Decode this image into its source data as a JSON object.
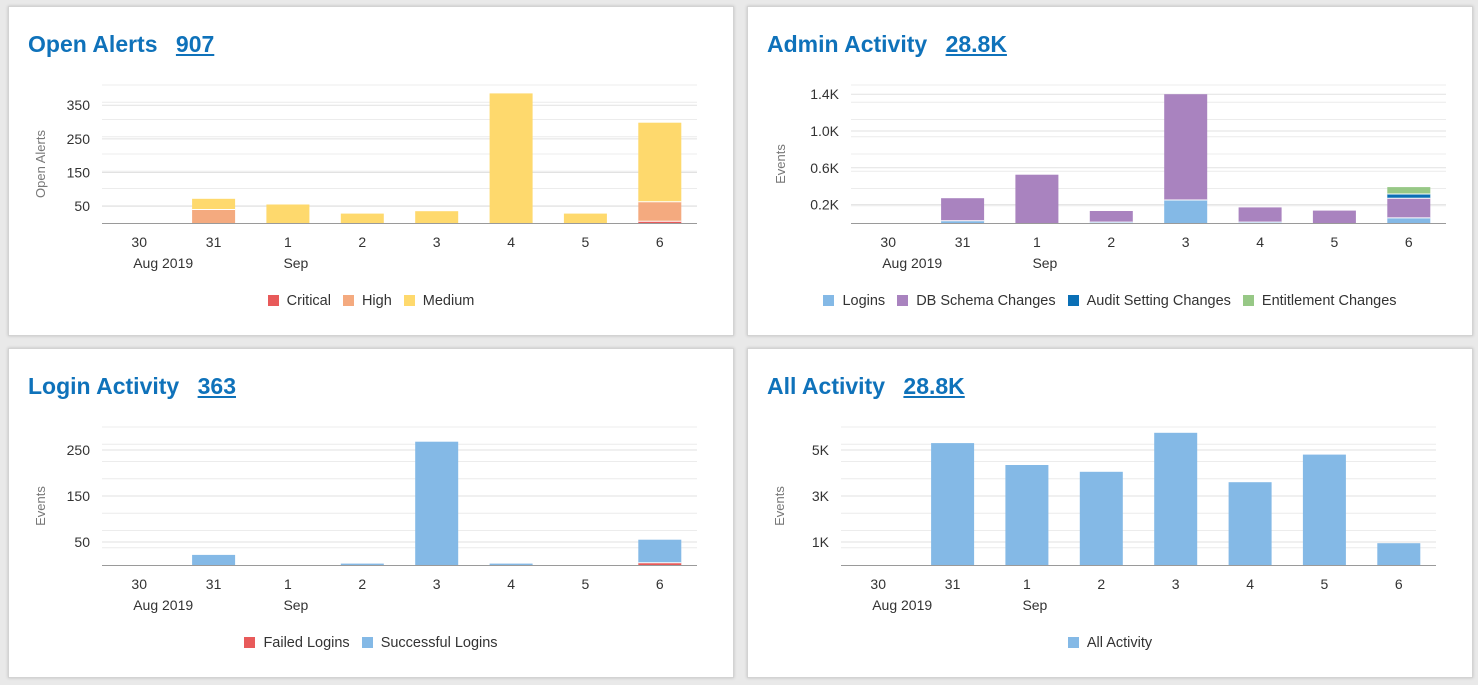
{
  "panels": [
    {
      "title": "Open Alerts",
      "total": "907",
      "chart_data": {
        "type": "bar",
        "stacked": true,
        "categories": [
          "30",
          "31",
          "1",
          "2",
          "3",
          "4",
          "5",
          "6"
        ],
        "category_groups": [
          "Aug 2019",
          "",
          "Sep",
          "",
          "",
          "",
          "",
          ""
        ],
        "ylabel": "Open Alerts",
        "yticks": [
          50,
          150,
          250,
          350
        ],
        "ytick_labels": [
          "50",
          "150",
          "250",
          "350"
        ],
        "ylim": [
          0,
          410
        ],
        "grid": true,
        "legend_position": "bottom",
        "series": [
          {
            "name": "Critical",
            "color": "#e85a5a",
            "values": [
              0,
              0,
              0,
              0,
              0,
              0,
              0,
              5
            ]
          },
          {
            "name": "High",
            "color": "#f4aa7f",
            "values": [
              0,
              40,
              0,
              0,
              0,
              0,
              0,
              58
            ]
          },
          {
            "name": "Medium",
            "color": "#fed96d",
            "values": [
              0,
              32,
              55,
              28,
              35,
              385,
              28,
              235
            ]
          }
        ]
      }
    },
    {
      "title": "Admin Activity",
      "total": "28.8K",
      "chart_data": {
        "type": "bar",
        "stacked": true,
        "categories": [
          "30",
          "31",
          "1",
          "2",
          "3",
          "4",
          "5",
          "6"
        ],
        "category_groups": [
          "Aug 2019",
          "",
          "Sep",
          "",
          "",
          "",
          "",
          ""
        ],
        "ylabel": "Events",
        "yticks": [
          200,
          600,
          1000,
          1400
        ],
        "ytick_labels": [
          "0.2K",
          "0.6K",
          "1.0K",
          "1.4K"
        ],
        "ylim": [
          0,
          1500
        ],
        "grid": true,
        "legend_position": "bottom",
        "series": [
          {
            "name": "Logins",
            "color": "#84b9e6",
            "values": [
              0,
              25,
              0,
              10,
              250,
              10,
              0,
              55
            ]
          },
          {
            "name": "DB Schema Changes",
            "color": "#a983bf",
            "values": [
              0,
              245,
              525,
              120,
              1150,
              160,
              135,
              215
            ]
          },
          {
            "name": "Audit Setting Changes",
            "color": "#0a6fb5",
            "values": [
              0,
              0,
              0,
              0,
              0,
              0,
              0,
              45
            ]
          },
          {
            "name": "Entitlement Changes",
            "color": "#97c886",
            "values": [
              0,
              0,
              0,
              0,
              0,
              0,
              0,
              75
            ]
          }
        ]
      }
    },
    {
      "title": "Login Activity",
      "total": "363",
      "chart_data": {
        "type": "bar",
        "stacked": true,
        "categories": [
          "30",
          "31",
          "1",
          "2",
          "3",
          "4",
          "5",
          "6"
        ],
        "category_groups": [
          "Aug 2019",
          "",
          "Sep",
          "",
          "",
          "",
          "",
          ""
        ],
        "ylabel": "Events",
        "yticks": [
          50,
          150,
          250
        ],
        "ytick_labels": [
          "50",
          "150",
          "250"
        ],
        "ylim": [
          0,
          300
        ],
        "grid": true,
        "legend_position": "bottom",
        "series": [
          {
            "name": "Failed Logins",
            "color": "#e85a5a",
            "values": [
              0,
              0,
              0,
              0,
              0,
              0,
              0,
              5
            ]
          },
          {
            "name": "Successful Logins",
            "color": "#84b9e6",
            "values": [
              0,
              22,
              0,
              3,
              268,
              3,
              0,
              50
            ]
          }
        ]
      }
    },
    {
      "title": "All Activity",
      "total": "28.8K",
      "chart_data": {
        "type": "bar",
        "stacked": false,
        "categories": [
          "30",
          "31",
          "1",
          "2",
          "3",
          "4",
          "5",
          "6"
        ],
        "category_groups": [
          "Aug 2019",
          "",
          "Sep",
          "",
          "",
          "",
          "",
          ""
        ],
        "ylabel": "Events",
        "yticks": [
          1000,
          3000,
          5000
        ],
        "ytick_labels": [
          "1K",
          "3K",
          "5K"
        ],
        "ylim": [
          0,
          6000
        ],
        "grid": true,
        "legend_position": "bottom",
        "series": [
          {
            "name": "All Activity",
            "color": "#84b9e6",
            "values": [
              0,
              5300,
              4350,
              4050,
              5750,
              3600,
              4800,
              950
            ]
          }
        ]
      }
    }
  ]
}
